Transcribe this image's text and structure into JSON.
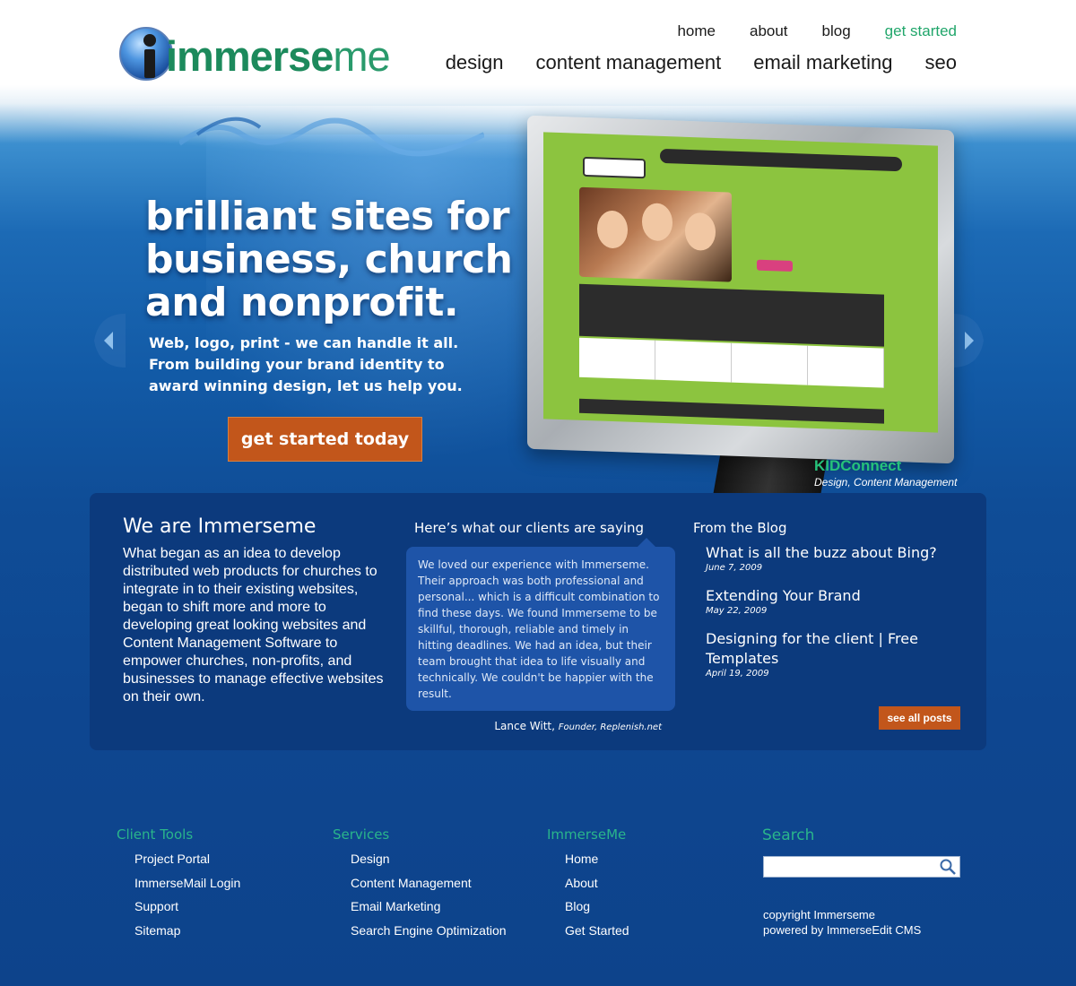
{
  "brand": {
    "logo_bold": "immerse",
    "logo_light": "me"
  },
  "topnav": [
    "home",
    "about",
    "blog",
    "get started"
  ],
  "mainnav": [
    "design",
    "content management",
    "email marketing",
    "seo"
  ],
  "hero": {
    "title": "brilliant sites for business, church and nonprofit.",
    "subtitle": "Web, logo, print - we can handle it all. From building your brand identity to award winning design, let us help you.",
    "cta": "get started today"
  },
  "showcase": {
    "client": "KIDConnect",
    "services": "Design, Content Management"
  },
  "about": {
    "title": "We are Immerseme",
    "body": "What began as an idea to develop distributed web products for churches to integrate in to their existing websites, began to shift more and more to developing great looking websites and Content Management Software to empower churches, non-profits, and businesses to manage effective websites on their own."
  },
  "testimonial": {
    "title": "Here’s what our clients are saying",
    "quote": "We loved our experience with Immerseme. Their approach was both professional and personal... which is a difficult combination to find these days. We found Immerseme to be skillful, thorough, reliable and timely in hitting deadlines.  We had an idea, but their team brought that idea to life visually and technically.  We couldn't be happier with the result.",
    "author": "Lance Witt,",
    "role": "Founder, Replenish.net"
  },
  "blog": {
    "title": "From the Blog",
    "posts": [
      {
        "title": "What is all the buzz about Bing?",
        "date": "June 7, 2009"
      },
      {
        "title": "Extending Your Brand",
        "date": "May 22, 2009"
      },
      {
        "title": "Designing for the client | Free Templates",
        "date": "April 19, 2009"
      }
    ],
    "see_all": "see all posts"
  },
  "footer": {
    "client_tools": {
      "title": "Client Tools",
      "items": [
        "Project Portal",
        "ImmerseMail Login",
        "Support",
        "Sitemap"
      ]
    },
    "services": {
      "title": "Services",
      "items": [
        "Design",
        "Content Management",
        "Email Marketing",
        "Search Engine Optimization"
      ]
    },
    "immerseme": {
      "title": "ImmerseMe",
      "items": [
        "Home",
        "About",
        "Blog",
        "Get Started"
      ]
    },
    "search": {
      "title": "Search",
      "placeholder": "",
      "icon": "magnifier-icon"
    },
    "copyright": "copyright Immerseme",
    "powered": "powered by ImmerseEdit CMS"
  },
  "colors": {
    "accent_green": "#21a66b",
    "button_orange": "#c2561b",
    "panel_blue": "#0c3a7d"
  }
}
